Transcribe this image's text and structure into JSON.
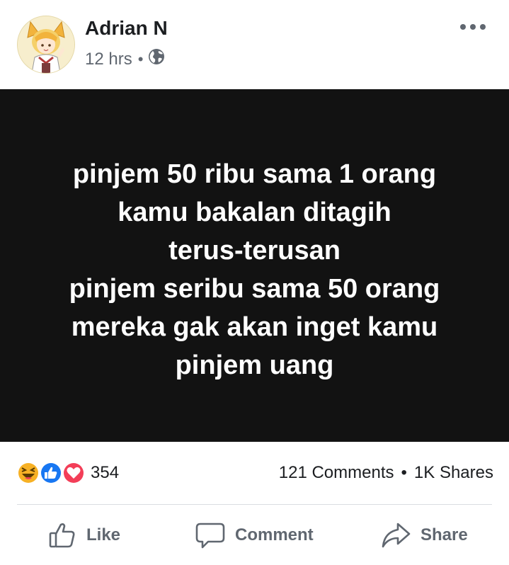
{
  "post": {
    "author": "Adrian N",
    "time": "12 hrs",
    "meta_separator": "•",
    "icons": {
      "avatar": "anime-avatar",
      "privacy": "globe-icon",
      "more": "more-options-icon"
    },
    "status_lines": [
      "pinjem 50 ribu sama 1 orang",
      "kamu bakalan ditagih",
      "terus-terusan",
      "pinjem seribu sama 50 orang",
      "mereka gak akan inget kamu",
      "pinjem uang"
    ],
    "panel_color": "#121212",
    "text_color": "#ffffff"
  },
  "reactions": {
    "types": [
      "haha",
      "like",
      "love"
    ],
    "count": "354"
  },
  "engagement": {
    "comments": "121 Comments",
    "separator": "•",
    "shares": "1K Shares"
  },
  "actions": {
    "like": "Like",
    "comment": "Comment",
    "share": "Share"
  },
  "colors": {
    "secondary_text": "#606770",
    "like_blue": "#1877f2",
    "love_red": "#f33e58",
    "haha_yellow": "#f7b125"
  }
}
